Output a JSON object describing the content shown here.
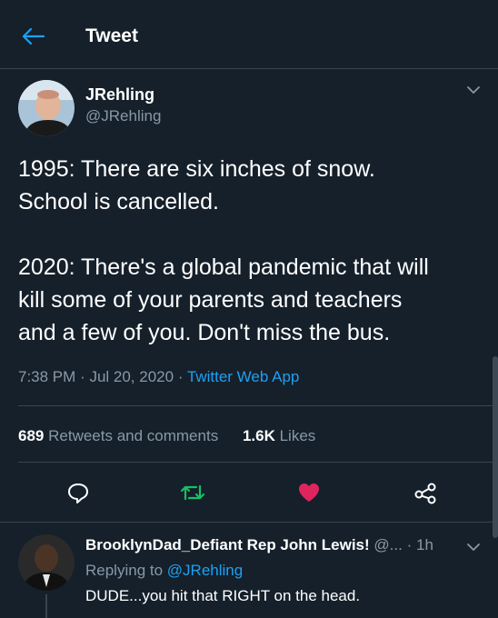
{
  "header": {
    "title": "Tweet",
    "back_icon": "arrow-left-icon"
  },
  "tweet": {
    "author_name": "JRehling",
    "author_handle": "@JRehling",
    "text_lines_1": [
      "1995: There are six inches of snow.",
      "School is cancelled."
    ],
    "text_lines_2": [
      "2020: There's a global pandemic that will",
      "kill some of your parents and teachers",
      "and a few of you. Don't miss the bus."
    ],
    "time": "7:38 PM",
    "date": "Jul 20, 2020",
    "source": "Twitter Web App",
    "retweets_count": "689",
    "retweets_label": "Retweets and comments",
    "likes_count": "1.6K",
    "likes_label": "Likes"
  },
  "actions": {
    "reply_icon": "comment-icon",
    "retweet_icon": "retweet-icon",
    "like_icon": "heart-icon",
    "share_icon": "share-icon"
  },
  "reply": {
    "name": "BrooklynDad_Defiant Rep John Lewis!",
    "handle_truncated": "@...",
    "separator": "·",
    "time": "1h",
    "replying_to_label": "Replying to",
    "replying_to_handle": "@JRehling",
    "text": "DUDE...you hit that RIGHT on the head."
  },
  "colors": {
    "background": "#15202b",
    "accent": "#1da1f2",
    "like": "#e0245e",
    "retweet": "#17bf63",
    "muted": "#8899a6"
  }
}
